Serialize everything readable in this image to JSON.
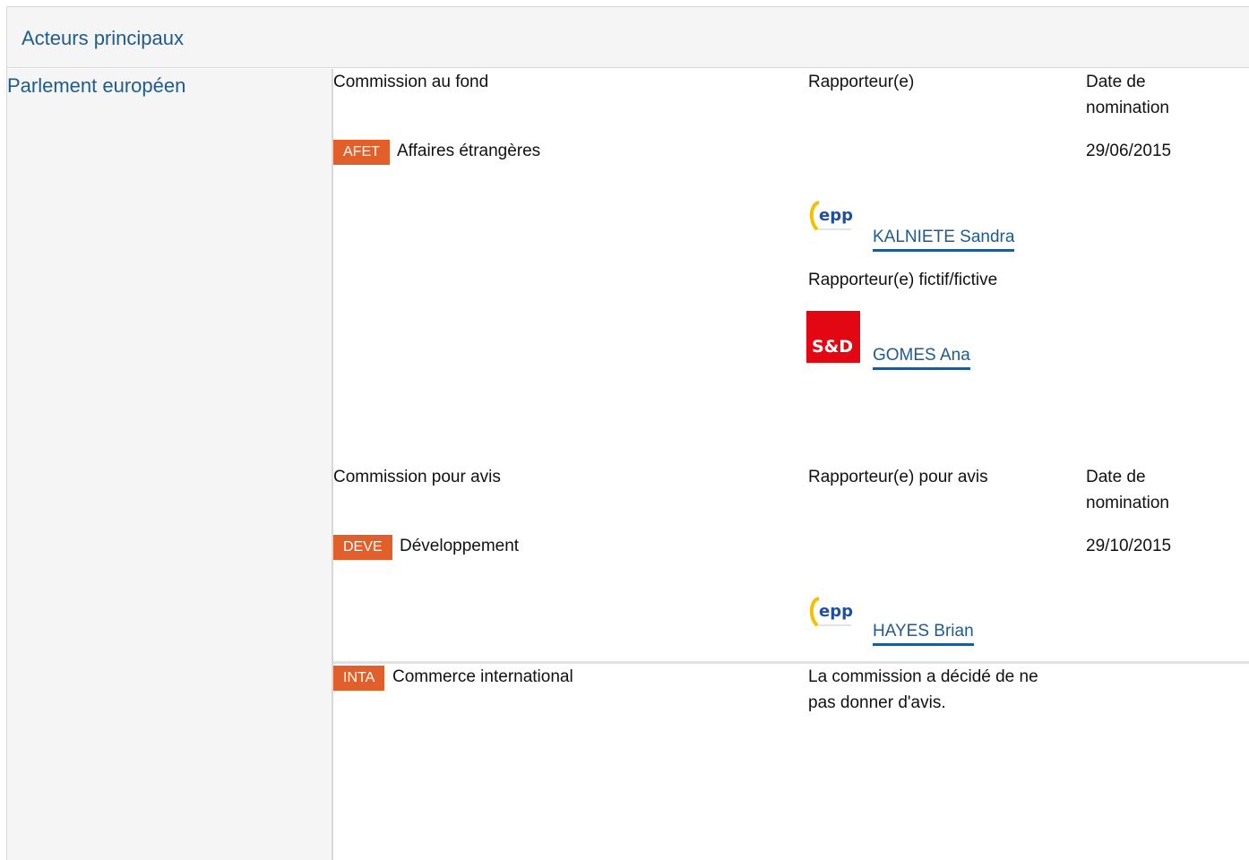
{
  "header": {
    "title": "Acteurs principaux"
  },
  "left": {
    "title": "Parlement européen"
  },
  "lead": {
    "col_committee": "Commission au fond",
    "col_rapporteur": "Rapporteur(e)",
    "col_date_line1": "Date de",
    "col_date_line2": "nomination",
    "committee_code": "AFET",
    "committee_name": "Affaires étrangères",
    "date": "29/06/2015",
    "rapporteur": {
      "group": "epp",
      "name": "KALNIETE Sandra"
    },
    "shadow_label": "Rapporteur(e) fictif/fictive",
    "shadow": {
      "group": "S&D",
      "name": "GOMES Ana"
    }
  },
  "opinion": {
    "col_committee": "Commission pour avis",
    "col_rapporteur": "Rapporteur(e) pour avis",
    "col_date_line1": "Date de",
    "col_date_line2": "nomination",
    "committee_code": "DEVE",
    "committee_name": "Développement",
    "date": "29/10/2015",
    "rapporteur": {
      "group": "epp",
      "name": "HAYES Brian"
    }
  },
  "no_opinion": {
    "committee_code": "INTA",
    "committee_name": "Commerce international",
    "note_line1": "La commission a décidé de ne",
    "note_line2": "pas donner d'avis."
  },
  "colors": {
    "link": "#1f5b8e",
    "badge": "#e15f2a",
    "sd_red": "#e30613",
    "epp_blue": "#1f4fa0",
    "epp_yellow": "#f2c200"
  }
}
